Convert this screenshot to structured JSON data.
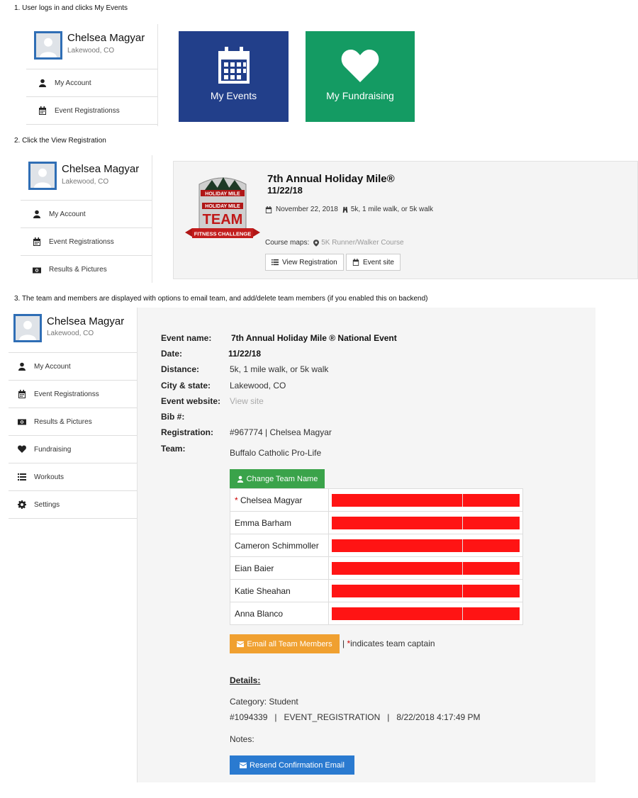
{
  "steps": {
    "s1": "1. User logs in and clicks My Events",
    "s2": "2. Click the View Registration",
    "s3": "3. The team and members are displayed with options to email team, and add/delete team members (if you enabled this on backend)"
  },
  "user": {
    "name": "Chelsea Magyar",
    "location": "Lakewood, CO"
  },
  "sidebar": {
    "my_account": "My Account",
    "event_registrations": "Event Registrationss",
    "results_pictures": "Results & Pictures",
    "fundraising": "Fundraising",
    "workouts": "Workouts",
    "settings": "Settings"
  },
  "tiles": {
    "events": {
      "label": "My Events",
      "color": "#223f8a"
    },
    "fundraising": {
      "label": "My Fundraising",
      "color": "#149b63"
    }
  },
  "event_card": {
    "title": "7th Annual Holiday Mile®",
    "date_short": "11/22/18",
    "date_long": "November 22, 2018",
    "distances": "5k, 1 mile walk, or 5k walk",
    "course_maps_label": "Course maps:",
    "course_map_link": "5K Runner/Walker Course",
    "view_registration": "View Registration",
    "event_site": "Event site",
    "logo": {
      "top": "HOLIDAY MILE",
      "mid": "HOLIDAY MILE",
      "team": "TEAM",
      "ribbon": "FITNESS CHALLENGE"
    }
  },
  "details": {
    "labels": {
      "event_name": "Event name:",
      "date": "Date:",
      "distance": "Distance:",
      "city_state": "City & state:",
      "website": "Event website:",
      "bib": "Bib #:",
      "registration": "Registration:",
      "team": "Team:"
    },
    "values": {
      "event_name": "7th Annual Holiday Mile ® National Event",
      "date": "11/22/18",
      "distance": "5k, 1 mile walk, or 5k walk",
      "city_state": "Lakewood, CO",
      "website": "View site",
      "registration": "#967774 | Chelsea Magyar",
      "team": "Buffalo Catholic Pro-Life"
    },
    "change_team_name": "Change Team Name",
    "members": [
      {
        "name": "Chelsea Magyar",
        "captain": "*"
      },
      {
        "name": "Emma Barham"
      },
      {
        "name": "Cameron Schimmoller"
      },
      {
        "name": "Eian Baier"
      },
      {
        "name": "Katie Sheahan"
      },
      {
        "name": "Anna Blanco"
      }
    ],
    "email_all": "Email all Team Members",
    "captain_note_prefix": "| ",
    "captain_star": "*",
    "captain_note": "indicates team captain",
    "details_heading": "Details:",
    "category": "Category: Student",
    "reg_line": "#1094339   |   EVENT_REGISTRATION   |   8/22/2018 4:17:49 PM",
    "notes": "Notes:",
    "resend": "Resend Confirmation Email"
  },
  "colors": {
    "green_button": "#3aa34a",
    "orange_button": "#f0a030",
    "blue_button": "#2a7ad0",
    "redaction": "#ff1414",
    "avatar_border": "#2f6eb5"
  },
  "icons": [
    "user-icon",
    "calendar-icon",
    "camera-icon",
    "heart-icon",
    "list-icon",
    "gear-icon",
    "map-pin-icon",
    "runner-icon",
    "envelope-icon"
  ]
}
